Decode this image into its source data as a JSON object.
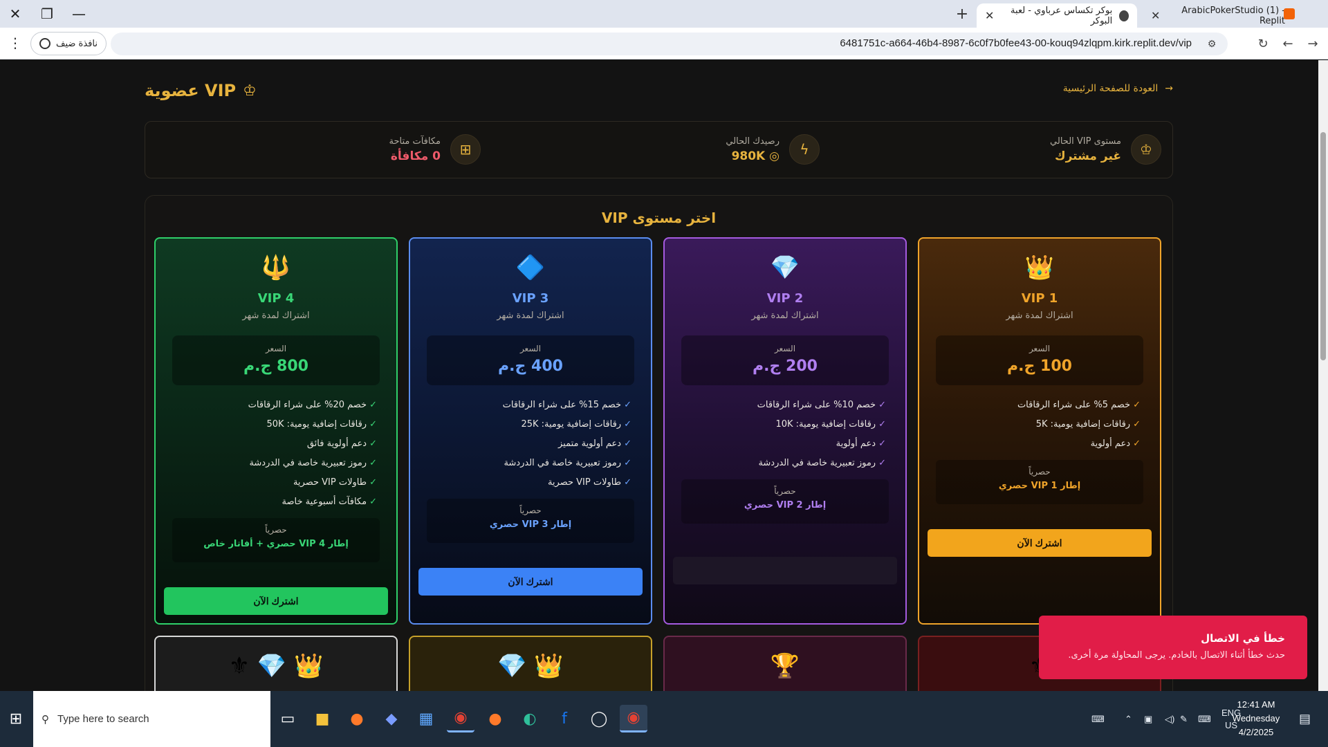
{
  "browser": {
    "tabs": [
      {
        "title": "ArabicPokerStudio (1) - Replit"
      },
      {
        "title": "بوكر تكساس عرباوي - لعبة البوكر"
      }
    ],
    "url": "6481751c-a664-46b4-8987-6c0f7b0fee43-00-kouq94zlqpm.kirk.replit.dev/vip",
    "guest_label": "نافذة ضيف",
    "new_tab": "+",
    "close": "✕",
    "minimize": "—",
    "restore": "❐"
  },
  "header": {
    "title": "VIP عضوية",
    "back_label": "العودة للصفحة الرئيسية"
  },
  "stats": {
    "level_label": "مستوى VIP الحالي",
    "level_value": "غير مشترك",
    "balance_label": "رصيدك الحالي",
    "balance_value": "980K",
    "rewards_label": "مكافآت متاحة",
    "rewards_value": "0 مكافأة"
  },
  "plans": {
    "title": "اختر مستوى VIP",
    "cards": [
      {
        "name": "VIP 1",
        "emoji": "👑",
        "subtitle": "اشتراك لمدة شهر",
        "price_label": "السعر",
        "price": "100 ج.م",
        "features": [
          "خصم 5% على شراء الرقاقات",
          "رقاقات إضافية يومية: 5K",
          "دعم أولوية"
        ],
        "exclusive_label": "حصرياً",
        "exclusive_value": "إطار VIP 1 حصري",
        "button": "اشترك الآن",
        "accent": "#f0a42a"
      },
      {
        "name": "VIP 2",
        "emoji": "💎",
        "subtitle": "اشتراك لمدة شهر",
        "price_label": "السعر",
        "price": "200 ج.م",
        "features": [
          "خصم 10% على شراء الرقاقات",
          "رقاقات إضافية يومية: 10K",
          "دعم أولوية",
          "رموز تعبيرية خاصة في الدردشة"
        ],
        "exclusive_label": "حصرياً",
        "exclusive_value": "إطار VIP 2 حصري",
        "button": "",
        "accent": "#a55be0"
      },
      {
        "name": "VIP 3",
        "emoji": "🔷",
        "subtitle": "اشتراك لمدة شهر",
        "price_label": "السعر",
        "price": "400 ج.م",
        "features": [
          "خصم 15% على شراء الرقاقات",
          "رقاقات إضافية يومية: 25K",
          "دعم أولوية متميز",
          "رموز تعبيرية خاصة في الدردشة",
          "طاولات VIP حصرية"
        ],
        "exclusive_label": "حصرياً",
        "exclusive_value": "إطار VIP 3 حصري",
        "button": "اشترك الآن",
        "accent": "#5b8df0"
      },
      {
        "name": "VIP 4",
        "emoji": "🔱",
        "subtitle": "اشتراك لمدة شهر",
        "price_label": "السعر",
        "price": "800 ج.م",
        "features": [
          "خصم 20% على شراء الرقاقات",
          "رقاقات إضافية يومية: 50K",
          "دعم أولوية فائق",
          "رموز تعبيرية خاصة في الدردشة",
          "طاولات VIP حصرية",
          "مكافآت أسبوعية خاصة"
        ],
        "exclusive_label": "حصرياً",
        "exclusive_value": "إطار VIP 4 حصري + أفاتار خاص",
        "button": "اشترك الآن",
        "accent": "#2fd06a"
      }
    ],
    "next_row_emojis": [
      "⚜",
      "",
      "👑 💎",
      "👑 💎 ⚜"
    ]
  },
  "toast": {
    "title": "خطأ في الاتصال",
    "message": "حدث خطأ أثناء الاتصال بالخادم. يرجى المحاولة مرة أخرى."
  },
  "taskbar": {
    "search_placeholder": "Type here to search",
    "lang": "ENG",
    "region": "US",
    "time": "12:41 AM",
    "day": "Wednesday",
    "date": "4/2/2025"
  }
}
